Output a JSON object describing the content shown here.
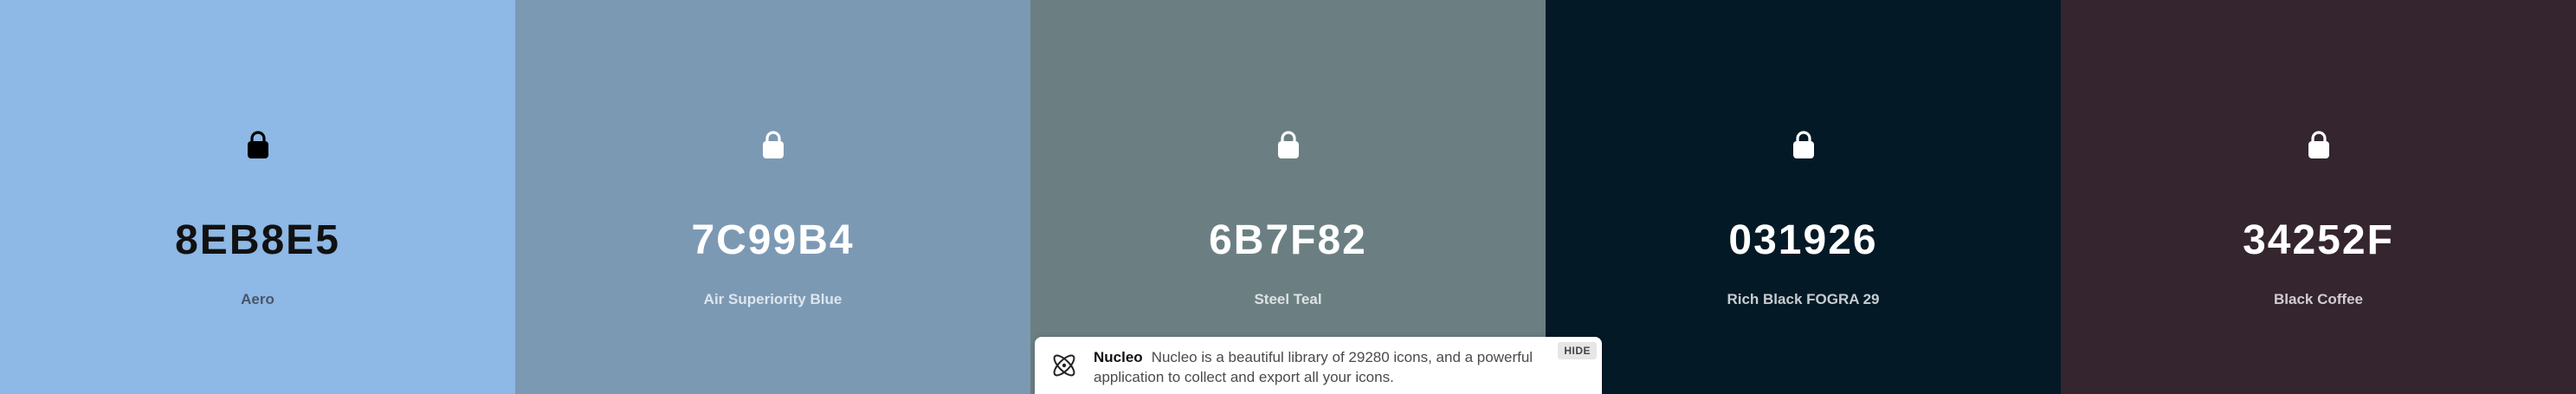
{
  "swatches": [
    {
      "hex": "8EB8E5",
      "name": "Aero",
      "background": "#8EB8E5",
      "hex_color": "#111111",
      "name_color": "#4a5568",
      "lock_color": "#000000"
    },
    {
      "hex": "7C99B4",
      "name": "Air Superiority Blue",
      "background": "#7C99B4",
      "hex_color": "#ffffff",
      "name_color": "#dde6ef",
      "lock_color": "#ffffff"
    },
    {
      "hex": "6B7F82",
      "name": "Steel Teal",
      "background": "#6B7F82",
      "hex_color": "#ffffff",
      "name_color": "#dce3e4",
      "lock_color": "#ffffff"
    },
    {
      "hex": "031926",
      "name": "Rich Black FOGRA 29",
      "background": "#031926",
      "hex_color": "#ffffff",
      "name_color": "#c6ccd0",
      "lock_color": "#ffffff"
    },
    {
      "hex": "34252F",
      "name": "Black Coffee",
      "background": "#34252F",
      "hex_color": "#ffffff",
      "name_color": "#d3ccd1",
      "lock_color": "#ffffff"
    }
  ],
  "banner": {
    "brand": "Nucleo",
    "message": "Nucleo is a beautiful library of 29280 icons, and a powerful application to collect and export all your icons.",
    "hide_label": "HIDE",
    "logo_icon": "atom-icon"
  }
}
